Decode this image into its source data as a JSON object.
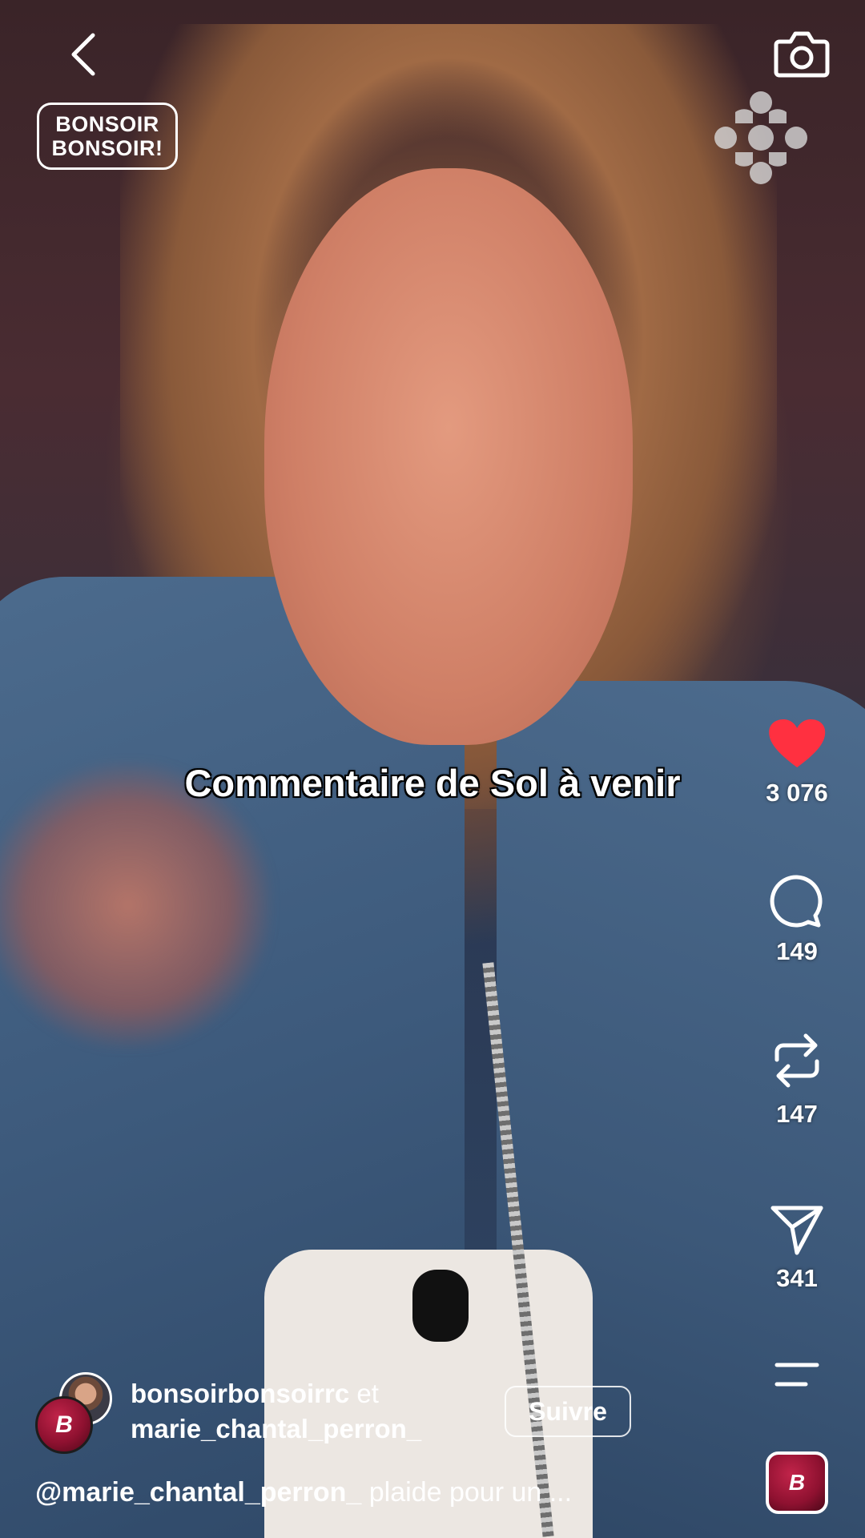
{
  "header": {
    "back_icon": "chevron-left-icon",
    "camera_icon": "camera-icon",
    "show_logo_line1": "BONSOIR",
    "show_logo_line2": "BONSOIR!",
    "network_logo": "cbc-gem-icon"
  },
  "video": {
    "caption": "Commentaire de Sol à venir"
  },
  "actions": {
    "like": {
      "icon": "heart-icon",
      "count": "3 076",
      "liked": true,
      "color": "#ff3040"
    },
    "comment": {
      "icon": "comment-icon",
      "count": "149"
    },
    "repost": {
      "icon": "repost-icon",
      "count": "147"
    },
    "share": {
      "icon": "send-icon",
      "count": "341"
    },
    "more": {
      "icon": "menu-icon"
    }
  },
  "post": {
    "author_primary": "bonsoirbonsoirrc",
    "joiner": "et",
    "author_secondary": "marie_chantal_perron_",
    "follow_label": "Suivre",
    "description_mention": "@marie_chantal_perron_",
    "description_text": " plaide pour un ..."
  },
  "colors": {
    "accent": "#ff3040",
    "brand": "#a0183c"
  }
}
